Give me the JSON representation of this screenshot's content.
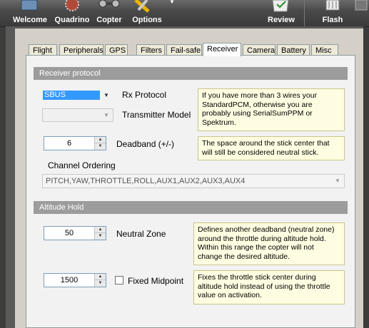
{
  "toolbar": {
    "welcome": "Welcome",
    "quadrino": "Quadrino",
    "copter": "Copter",
    "options": "Options",
    "review": "Review",
    "flash": "Flash"
  },
  "tabs": [
    "Flight",
    "Peripherals",
    "GPS",
    "Filters",
    "Fail-safe",
    "Receiver",
    "Camera",
    "Battery",
    "Misc"
  ],
  "active_tab": "Receiver",
  "receiver_protocol": {
    "header": "Receiver protocol",
    "rx_protocol_value": "SBUS",
    "rx_protocol_label": "Rx Protocol",
    "rx_hint": "If you have more than 3 wires your StandardPCM, otherwise you are probably using SerialSumPPM or Spektrum.",
    "transmitter_model_value": "",
    "transmitter_model_label": "Transmitter Model",
    "deadband_value": "6",
    "deadband_label": "Deadband (+/-)",
    "deadband_hint": "The space around the stick center that will still be considered neutral stick.",
    "channel_ordering_label": "Channel Ordering",
    "channel_ordering_value": "PITCH,YAW,THROTTLE,ROLL,AUX1,AUX2,AUX3,AUX4"
  },
  "altitude_hold": {
    "header": "Altitude Hold",
    "neutral_zone_value": "50",
    "neutral_zone_label": "Neutral Zone",
    "neutral_zone_hint": "Defines another deadband (neutral zone) around the throttle during altitude hold. Within this range the copter will not change the desired altitude.",
    "midpoint_value": "1500",
    "fixed_midpoint_label": "Fixed Midpoint",
    "fixed_midpoint_checked": false,
    "midpoint_hint": "Fixes the throttle stick center during altitude hold instead of using the throttle value on activation."
  },
  "colors": {
    "selection": "#3399ff",
    "section_header": "#9c9c9c",
    "hint_bg": "#fffde1"
  }
}
